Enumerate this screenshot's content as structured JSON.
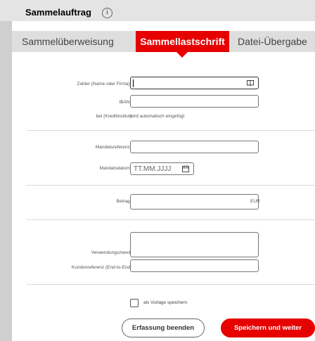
{
  "header": {
    "title": "Sammelauftrag"
  },
  "tabs": [
    {
      "label": "Sammelüberweisung",
      "active": false
    },
    {
      "label": "Sammellastschrift",
      "active": true
    },
    {
      "label": "Datei-Übergabe",
      "active": false
    }
  ],
  "form": {
    "payer_label": "Zahler (Name oder Firma)*:",
    "payer_value": "",
    "iban_label": "IBAN*:",
    "iban_value": "",
    "bank_label": "bei (Kreditinstitut):",
    "bank_value": "wird automatisch eingefügt",
    "mandate_ref_label": "Mandatsreferenz*:",
    "mandate_ref_value": "",
    "mandate_date_label": "Mandatsdatum*:",
    "mandate_date_placeholder": "TT.MM.JJJJ",
    "amount_label": "Betrag*:",
    "amount_value": "",
    "currency": "EUR",
    "purpose_label": "Verwendungszweck:",
    "purpose_value": "",
    "customer_ref_label": "Kundenreferenz (End-to-End):",
    "customer_ref_value": ""
  },
  "template_checkbox": {
    "label": "als Vorlage speichern",
    "checked": false
  },
  "buttons": {
    "end_capture": "Erfassung beenden",
    "save_continue": "Speichern und weiter"
  },
  "colors": {
    "accent": "#e60000"
  },
  "icons": {
    "info": "info-icon",
    "address_book": "address-book-icon",
    "calendar": "calendar-icon"
  }
}
